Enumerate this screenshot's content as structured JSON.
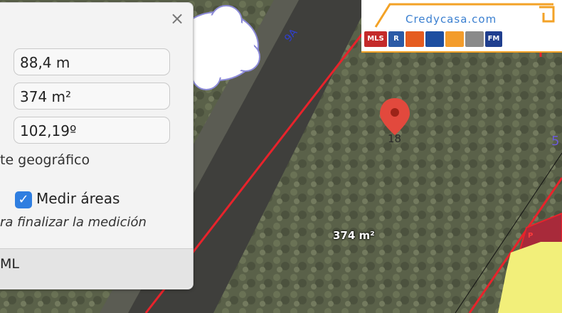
{
  "measure_panel": {
    "distance_value": "88,4 m",
    "area_value": "374 m²",
    "bearing_value": "102,19º",
    "geo_label": "te geográfico",
    "measure_areas_label": "Medir áreas",
    "measure_areas_checked": true,
    "finish_hint": "ra finalizar la medición",
    "export_label": "ML",
    "close_glyph": "×"
  },
  "map": {
    "area_label": "374 m²",
    "marker_number": "18",
    "road_label": "9A",
    "side_label": "5",
    "plot_letter": "P"
  },
  "banner": {
    "brand": "Credycasa.com",
    "logos": [
      "MLS",
      "R",
      "FM"
    ]
  },
  "colors": {
    "parcel_line": "#e8232b",
    "marker": "#e2493d",
    "checkbox": "#2f7ee0",
    "banner_accent": "#f3a226"
  }
}
